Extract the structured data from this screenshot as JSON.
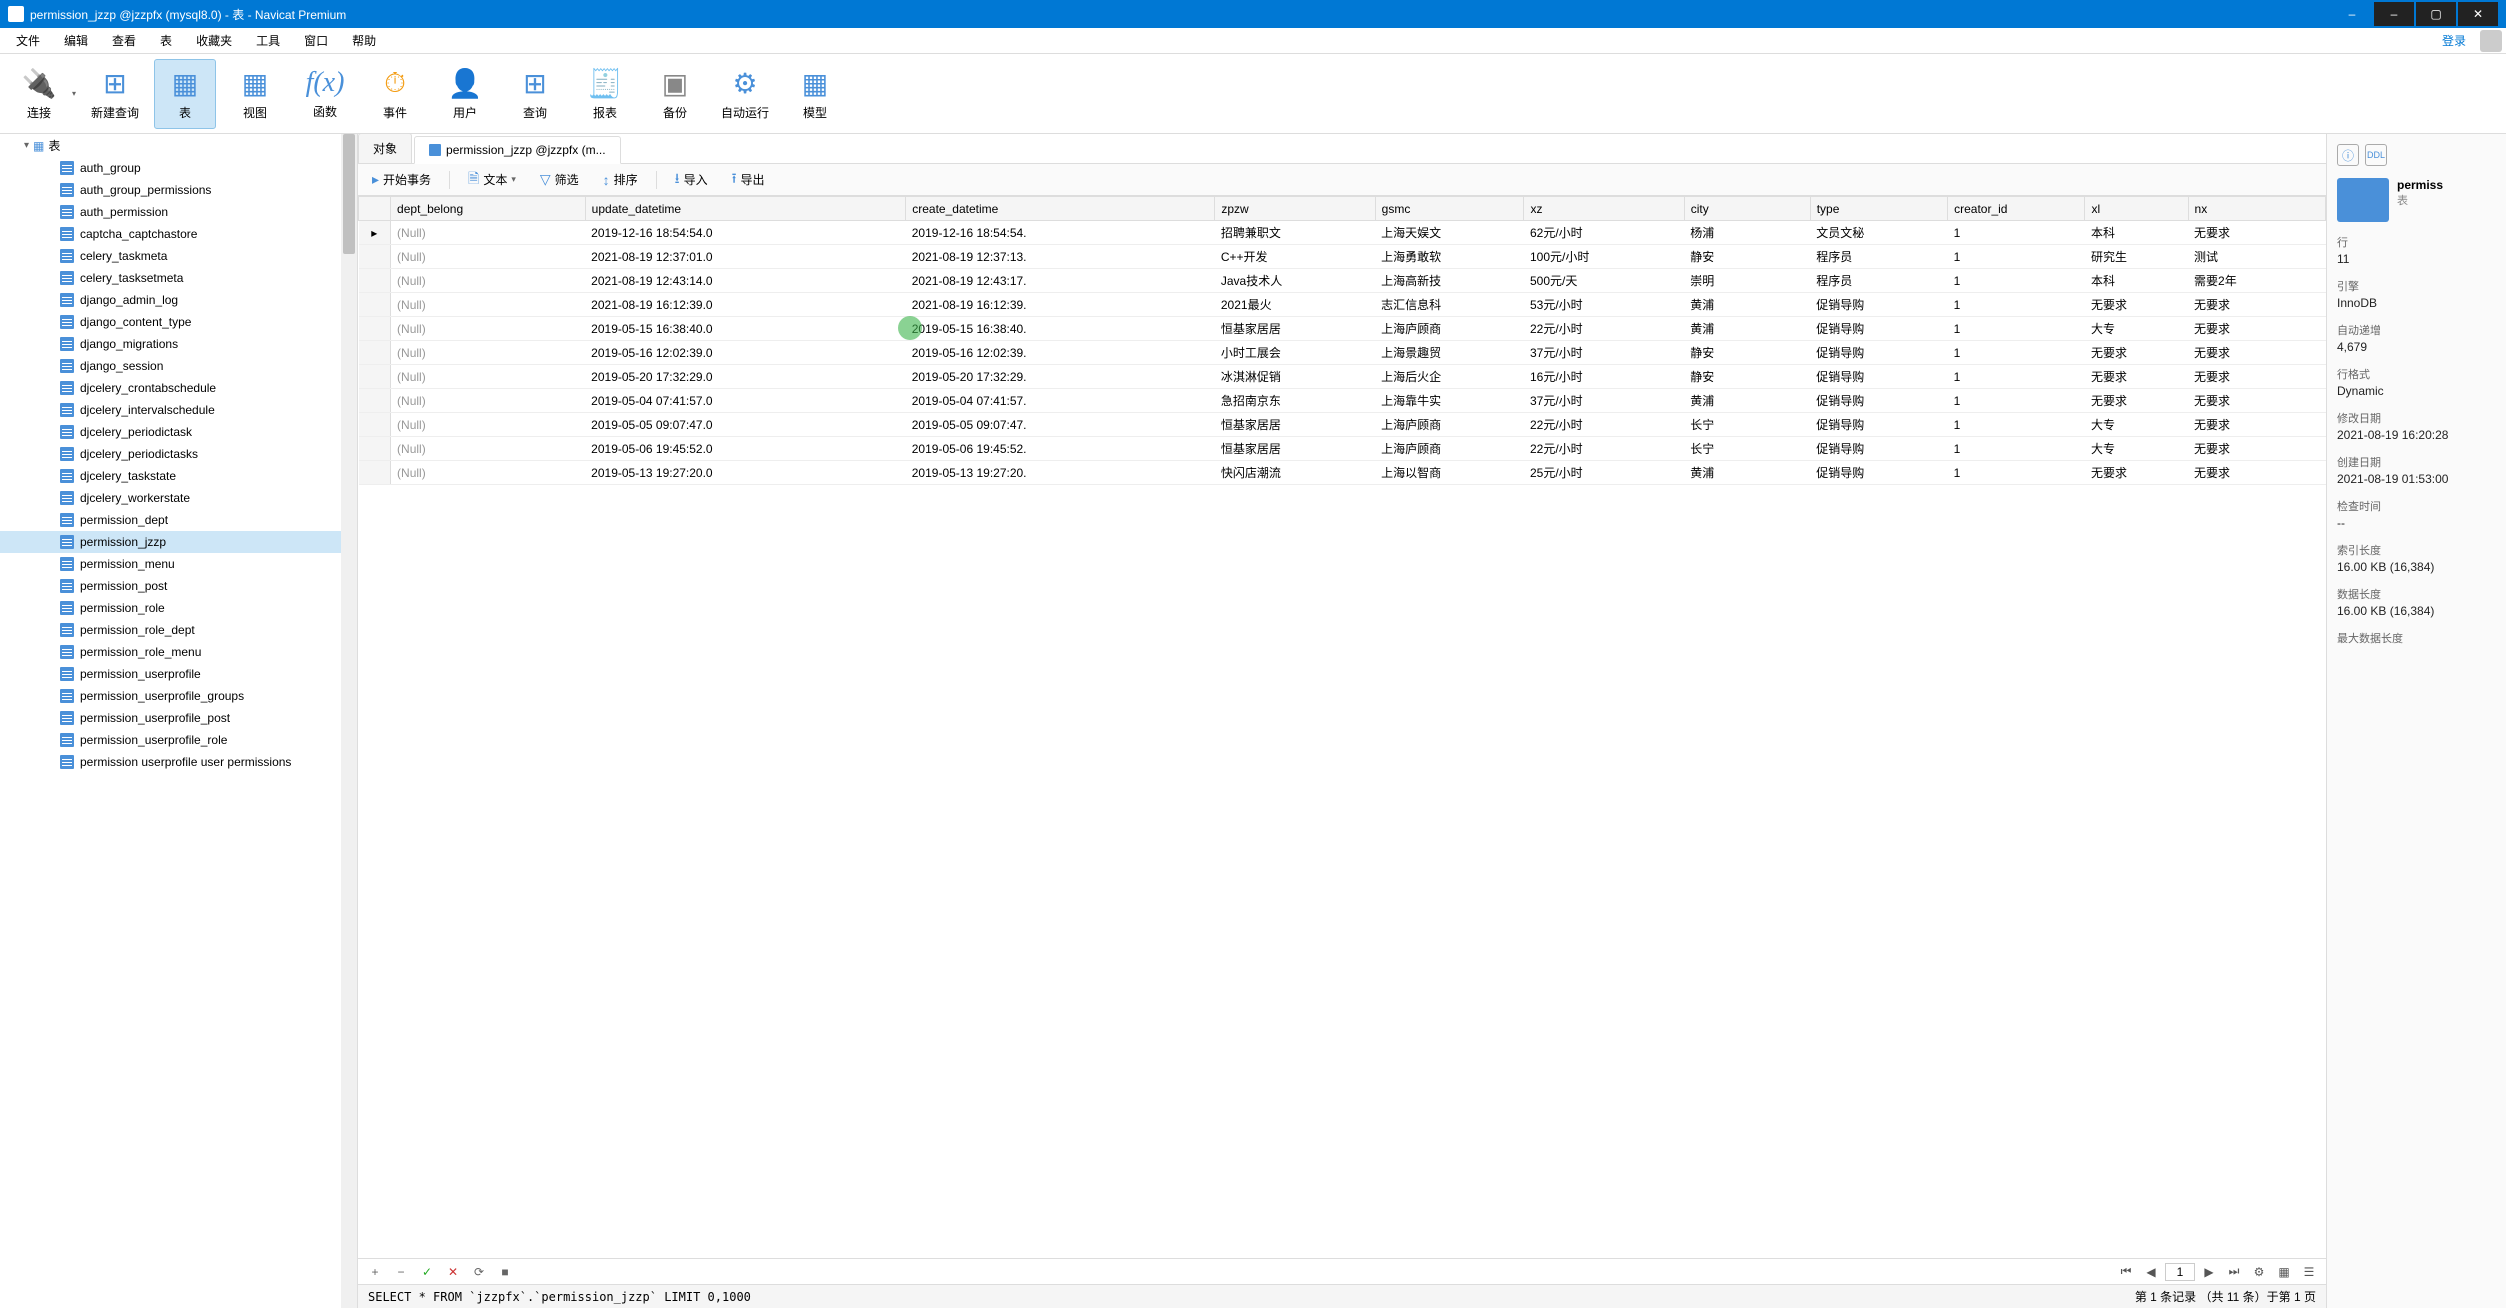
{
  "window": {
    "title": "permission_jzzp @jzzpfx (mysql8.0) - 表 - Navicat Premium",
    "min": "–",
    "max": "▢",
    "close": "✕"
  },
  "menu": {
    "items": [
      "文件",
      "编辑",
      "查看",
      "表",
      "收藏夹",
      "工具",
      "窗口",
      "帮助"
    ],
    "login": "登录"
  },
  "ribbon": [
    {
      "label": "连接",
      "icon": "🔌",
      "drop": true
    },
    {
      "label": "新建查询",
      "icon": "🗔"
    },
    {
      "label": "表",
      "icon": "▦",
      "active": true
    },
    {
      "label": "视图",
      "icon": "▦"
    },
    {
      "label": "函数",
      "icon": "f(x)",
      "fn": true
    },
    {
      "label": "事件",
      "icon": "⏱"
    },
    {
      "label": "用户",
      "icon": "👤",
      "orange": true
    },
    {
      "label": "查询",
      "icon": "🗔"
    },
    {
      "label": "报表",
      "icon": "🧾"
    },
    {
      "label": "备份",
      "icon": "💾",
      "gray": true
    },
    {
      "label": "自动运行",
      "icon": "⚙"
    },
    {
      "label": "模型",
      "icon": "▦"
    }
  ],
  "tree": {
    "root": "表",
    "items": [
      "auth_group",
      "auth_group_permissions",
      "auth_permission",
      "captcha_captchastore",
      "celery_taskmeta",
      "celery_tasksetmeta",
      "django_admin_log",
      "django_content_type",
      "django_migrations",
      "django_session",
      "djcelery_crontabschedule",
      "djcelery_intervalschedule",
      "djcelery_periodictask",
      "djcelery_periodictasks",
      "djcelery_taskstate",
      "djcelery_workerstate",
      "permission_dept",
      "permission_jzzp",
      "permission_menu",
      "permission_post",
      "permission_role",
      "permission_role_dept",
      "permission_role_menu",
      "permission_userprofile",
      "permission_userprofile_groups",
      "permission_userprofile_post",
      "permission_userprofile_role",
      "permission userprofile user permissions"
    ],
    "selected": "permission_jzzp"
  },
  "tabs": [
    {
      "label": "对象"
    },
    {
      "label": "permission_jzzp @jzzpfx (m...",
      "active": true,
      "icon": true
    }
  ],
  "actions": {
    "begin": "开始事务",
    "text": "文本",
    "filter": "筛选",
    "sort": "排序",
    "import": "导入",
    "export": "导出"
  },
  "columns": [
    "dept_belong",
    "update_datetime",
    "create_datetime",
    "zpzw",
    "gsmc",
    "xz",
    "city",
    "type",
    "creator_id",
    "xl",
    "nx"
  ],
  "rows": [
    {
      "dept_belong": "(Null)",
      "update_datetime": "2019-12-16 18:54:54.0",
      "create_datetime": "2019-12-16 18:54:54.",
      "zpzw": "招聘兼职文",
      "gsmc": "上海天娱文",
      "xz": "62元/小时",
      "city": "杨浦",
      "type": "文员文秘",
      "creator_id": "1",
      "xl": "本科",
      "nx": "无要求",
      "mark": true
    },
    {
      "dept_belong": "(Null)",
      "update_datetime": "2021-08-19 12:37:01.0",
      "create_datetime": "2021-08-19 12:37:13.",
      "zpzw": "C++开发",
      "gsmc": "上海勇敢软",
      "xz": "100元/小时",
      "city": "静安",
      "type": "程序员",
      "creator_id": "1",
      "xl": "研究生",
      "nx": "测试"
    },
    {
      "dept_belong": "(Null)",
      "update_datetime": "2021-08-19 12:43:14.0",
      "create_datetime": "2021-08-19 12:43:17.",
      "zpzw": "Java技术人",
      "gsmc": "上海高新技",
      "xz": "500元/天",
      "city": "崇明",
      "type": "程序员",
      "creator_id": "1",
      "xl": "本科",
      "nx": "需要2年"
    },
    {
      "dept_belong": "(Null)",
      "update_datetime": "2021-08-19 16:12:39.0",
      "create_datetime": "2021-08-19 16:12:39.",
      "zpzw": "2021最火",
      "gsmc": "志汇信息科",
      "xz": "53元/小时",
      "city": "黄浦",
      "type": "促销导购",
      "creator_id": "1",
      "xl": "无要求",
      "nx": "无要求"
    },
    {
      "dept_belong": "(Null)",
      "update_datetime": "2019-05-15 16:38:40.0",
      "create_datetime": "2019-05-15 16:38:40.",
      "zpzw": "恒基家居居",
      "gsmc": "上海庐顾商",
      "xz": "22元/小时",
      "city": "黄浦",
      "type": "促销导购",
      "creator_id": "1",
      "xl": "大专",
      "nx": "无要求"
    },
    {
      "dept_belong": "(Null)",
      "update_datetime": "2019-05-16 12:02:39.0",
      "create_datetime": "2019-05-16 12:02:39.",
      "zpzw": "小时工展会",
      "gsmc": "上海景趣贸",
      "xz": "37元/小时",
      "city": "静安",
      "type": "促销导购",
      "creator_id": "1",
      "xl": "无要求",
      "nx": "无要求"
    },
    {
      "dept_belong": "(Null)",
      "update_datetime": "2019-05-20 17:32:29.0",
      "create_datetime": "2019-05-20 17:32:29.",
      "zpzw": "冰淇淋促销",
      "gsmc": "上海后火企",
      "xz": "16元/小时",
      "city": "静安",
      "type": "促销导购",
      "creator_id": "1",
      "xl": "无要求",
      "nx": "无要求"
    },
    {
      "dept_belong": "(Null)",
      "update_datetime": "2019-05-04 07:41:57.0",
      "create_datetime": "2019-05-04 07:41:57.",
      "zpzw": "急招南京东",
      "gsmc": "上海靠牛实",
      "xz": "37元/小时",
      "city": "黄浦",
      "type": "促销导购",
      "creator_id": "1",
      "xl": "无要求",
      "nx": "无要求"
    },
    {
      "dept_belong": "(Null)",
      "update_datetime": "2019-05-05 09:07:47.0",
      "create_datetime": "2019-05-05 09:07:47.",
      "zpzw": "恒基家居居",
      "gsmc": "上海庐顾商",
      "xz": "22元/小时",
      "city": "长宁",
      "type": "促销导购",
      "creator_id": "1",
      "xl": "大专",
      "nx": "无要求"
    },
    {
      "dept_belong": "(Null)",
      "update_datetime": "2019-05-06 19:45:52.0",
      "create_datetime": "2019-05-06 19:45:52.",
      "zpzw": "恒基家居居",
      "gsmc": "上海庐顾商",
      "xz": "22元/小时",
      "city": "长宁",
      "type": "促销导购",
      "creator_id": "1",
      "xl": "大专",
      "nx": "无要求"
    },
    {
      "dept_belong": "(Null)",
      "update_datetime": "2019-05-13 19:27:20.0",
      "create_datetime": "2019-05-13 19:27:20.",
      "zpzw": "快闪店潮流",
      "gsmc": "上海以智商",
      "xz": "25元/小时",
      "city": "黄浦",
      "type": "促销导购",
      "creator_id": "1",
      "xl": "无要求",
      "nx": "无要求"
    }
  ],
  "pager": {
    "page": "1"
  },
  "sql": "SELECT * FROM `jzzpfx`.`permission_jzzp` LIMIT 0,1000",
  "status": "第 1 条记录 （共 11 条）于第 1 页",
  "detail": {
    "name": "permiss",
    "sub": "表",
    "rows_l": "行",
    "rows_v": "11",
    "engine_l": "引擎",
    "engine_v": "InnoDB",
    "autoinc_l": "自动递增",
    "autoinc_v": "4,679",
    "rowfmt_l": "行格式",
    "rowfmt_v": "Dynamic",
    "mod_l": "修改日期",
    "mod_v": "2021-08-19 16:20:28",
    "crt_l": "创建日期",
    "crt_v": "2021-08-19 01:53:00",
    "chk_l": "检查时间",
    "chk_v": "--",
    "idx_l": "索引长度",
    "idx_v": "16.00 KB (16,384)",
    "data_l": "数据长度",
    "data_v": "16.00 KB (16,384)",
    "max_l": "最大数据长度"
  }
}
